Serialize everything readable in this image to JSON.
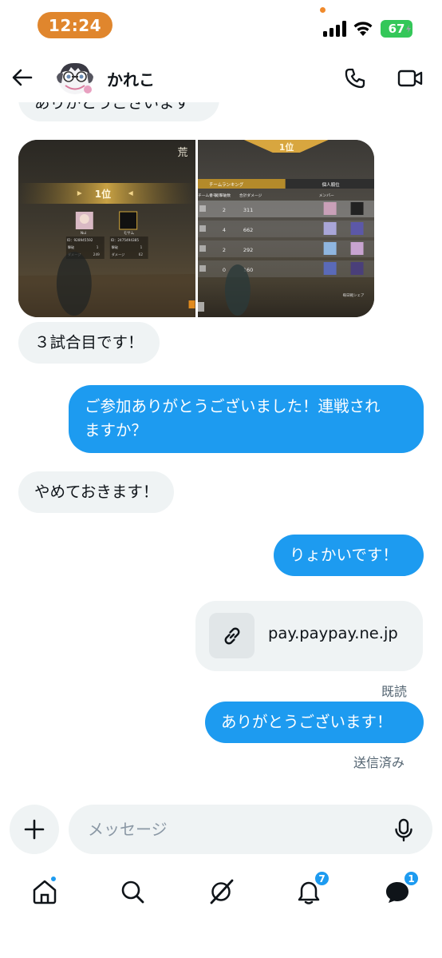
{
  "status_bar": {
    "time": "12:24",
    "battery": "67"
  },
  "header": {
    "contact_name": "かれこ"
  },
  "chat": {
    "cut_message": "ありがとうございます",
    "images": {
      "left": {
        "top_glyph": "荒",
        "rank": "1位",
        "player1_name": "Nui",
        "player1_id": "ID：928945592",
        "player1_stat1_label": "撃破",
        "player1_stat1_value": "1",
        "player1_stat2_label": "ダメージ",
        "player1_stat2_value": "249",
        "player2_name": "モサム",
        "player2_id": "ID：2475494385",
        "player2_stat1_label": "撃破",
        "player2_stat1_value": "1",
        "player2_stat2_label": "ダメージ",
        "player2_stat2_value": "62"
      },
      "right": {
        "rank": "1位",
        "tab_team": "チームランキング",
        "tab_personal": "個人順位",
        "col_team": "チーム番号",
        "col_kills": "総撃破数",
        "col_damage": "合計ダメージ",
        "col_members": "メンバー",
        "rows": [
          {
            "kills": "2",
            "damage": "311"
          },
          {
            "kills": "4",
            "damage": "662"
          },
          {
            "kills": "2",
            "damage": "292"
          },
          {
            "kills": "0",
            "damage": "160"
          }
        ],
        "footer": "毎日戦シェア"
      }
    },
    "messages": [
      {
        "text": "３試合目です！"
      },
      {
        "text_line1": "ご参加ありがとうございました！連戦され",
        "text_line2": "ますか？"
      },
      {
        "text": "やめておきます！"
      },
      {
        "text": "りょかいです！"
      }
    ],
    "link": {
      "domain": "pay.paypay.ne.jp"
    },
    "read_status": "既読",
    "last_message": "ありがとうございます！",
    "sent_status": "送信済み"
  },
  "composer": {
    "placeholder": "メッセージ"
  },
  "nav": {
    "notifications_badge": "7",
    "messages_badge": "1"
  },
  "colors": {
    "accent": "#1d9bf0",
    "incoming_bubble": "#eff3f4",
    "time_pill": "#e0862d",
    "battery": "#34c759"
  }
}
